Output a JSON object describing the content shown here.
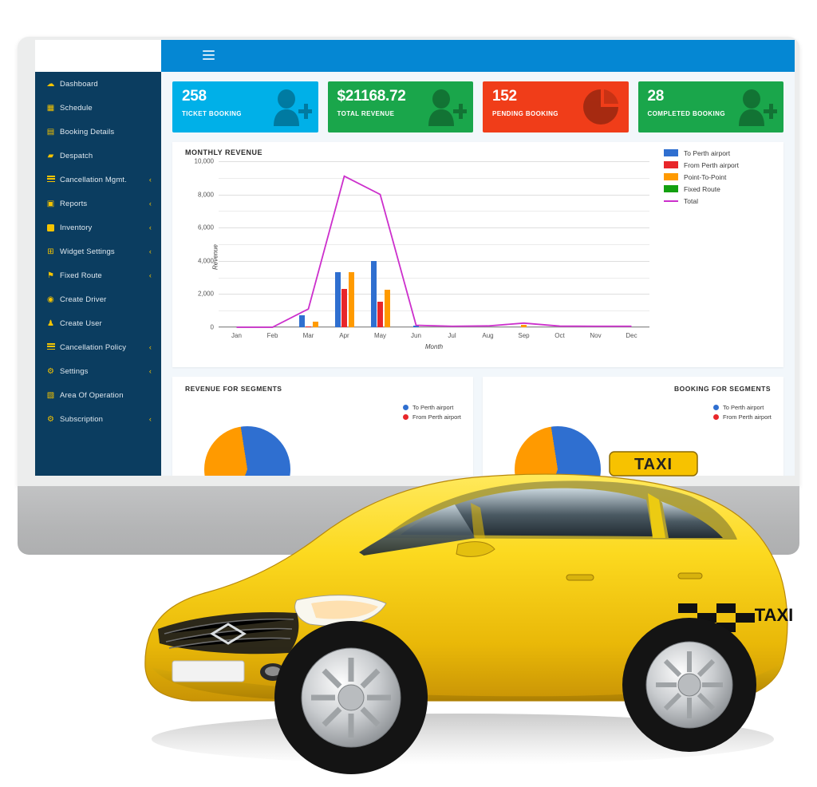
{
  "topbar": {
    "menu_icon": "hamburger-icon"
  },
  "sidebar": {
    "items": [
      {
        "label": "Dashboard",
        "icon": "dashboard-icon",
        "caret": ""
      },
      {
        "label": "Schedule",
        "icon": "calendar-icon",
        "caret": ""
      },
      {
        "label": "Booking Details",
        "icon": "file-icon",
        "caret": ""
      },
      {
        "label": "Despatch",
        "icon": "truck-icon",
        "caret": ""
      },
      {
        "label": "Cancellation Mgmt.",
        "icon": "list-icon",
        "caret": "‹"
      },
      {
        "label": "Reports",
        "icon": "report-icon",
        "caret": "‹"
      },
      {
        "label": "Inventory",
        "icon": "box-icon",
        "caret": "‹"
      },
      {
        "label": "Widget Settings",
        "icon": "grid-icon",
        "caret": "‹"
      },
      {
        "label": "Fixed Route",
        "icon": "map-pin-icon",
        "caret": "‹"
      },
      {
        "label": "Create Driver",
        "icon": "user-circle-icon",
        "caret": ""
      },
      {
        "label": "Create User",
        "icon": "user-icon",
        "caret": ""
      },
      {
        "label": "Cancellation Policy",
        "icon": "list-icon",
        "caret": "‹"
      },
      {
        "label": "Settings",
        "icon": "gears-icon",
        "caret": "‹"
      },
      {
        "label": "Area Of Operation",
        "icon": "map-icon",
        "caret": ""
      },
      {
        "label": "Subscription",
        "icon": "gears-icon",
        "caret": "‹"
      }
    ]
  },
  "cards": [
    {
      "value": "258",
      "caption": "TICKET BOOKING",
      "color": "#00b0e8",
      "icon": "user-plus-icon"
    },
    {
      "value": "$21168.72",
      "caption": "TOTAL REVENUE",
      "color": "#1aa64b",
      "icon": "user-plus-icon"
    },
    {
      "value": "152",
      "caption": "PENDING BOOKING",
      "color": "#f03d19",
      "icon": "pie-chart-icon"
    },
    {
      "value": "28",
      "caption": "COMPLETED BOOKING",
      "color": "#1aa64b",
      "icon": "user-plus-icon"
    }
  ],
  "lower_panels": [
    {
      "title": "REVENUE FOR SEGMENTS",
      "legend": [
        {
          "label": "To Perth airport",
          "color": "#2f6fd0"
        },
        {
          "label": "From Perth airport",
          "color": "#e8262a"
        }
      ]
    },
    {
      "title": "BOOKING FOR SEGMENTS",
      "legend": [
        {
          "label": "To Perth airport",
          "color": "#2f6fd0"
        },
        {
          "label": "From Perth airport",
          "color": "#e8262a"
        }
      ]
    }
  ],
  "chart_data": {
    "type": "bar",
    "title": "MONTHLY REVENUE",
    "xlabel": "Month",
    "ylabel": "Revenue",
    "ylim": [
      0,
      10000
    ],
    "yticks": [
      0,
      2000,
      4000,
      6000,
      8000,
      10000
    ],
    "ytick_labels": [
      "0",
      "2,000",
      "4,000",
      "6,000",
      "8,000",
      "10,000"
    ],
    "grid": true,
    "legend_position": "right",
    "categories": [
      "Jan",
      "Feb",
      "Mar",
      "Apr",
      "May",
      "Jun",
      "Jul",
      "Aug",
      "Sep",
      "Oct",
      "Nov",
      "Dec"
    ],
    "series": [
      {
        "name": "To Perth airport",
        "color": "#2f6fd0",
        "type": "bar",
        "values": [
          0,
          0,
          700,
          3300,
          4000,
          120,
          0,
          0,
          0,
          0,
          0,
          0
        ]
      },
      {
        "name": "From Perth airport",
        "color": "#e8262a",
        "type": "bar",
        "values": [
          0,
          0,
          60,
          2300,
          1550,
          0,
          0,
          0,
          0,
          0,
          0,
          0
        ]
      },
      {
        "name": "Point-To-Point",
        "color": "#ff9a00",
        "type": "bar",
        "values": [
          0,
          0,
          350,
          3300,
          2250,
          0,
          0,
          0,
          130,
          0,
          0,
          0
        ]
      },
      {
        "name": "Fixed Route",
        "color": "#13a010",
        "type": "bar",
        "values": [
          0,
          0,
          0,
          0,
          0,
          0,
          0,
          0,
          0,
          0,
          0,
          0
        ]
      },
      {
        "name": "Total",
        "color": "#cc2fcc",
        "type": "line",
        "values": [
          0,
          0,
          1100,
          9100,
          8000,
          120,
          60,
          80,
          250,
          70,
          60,
          60
        ]
      }
    ]
  }
}
